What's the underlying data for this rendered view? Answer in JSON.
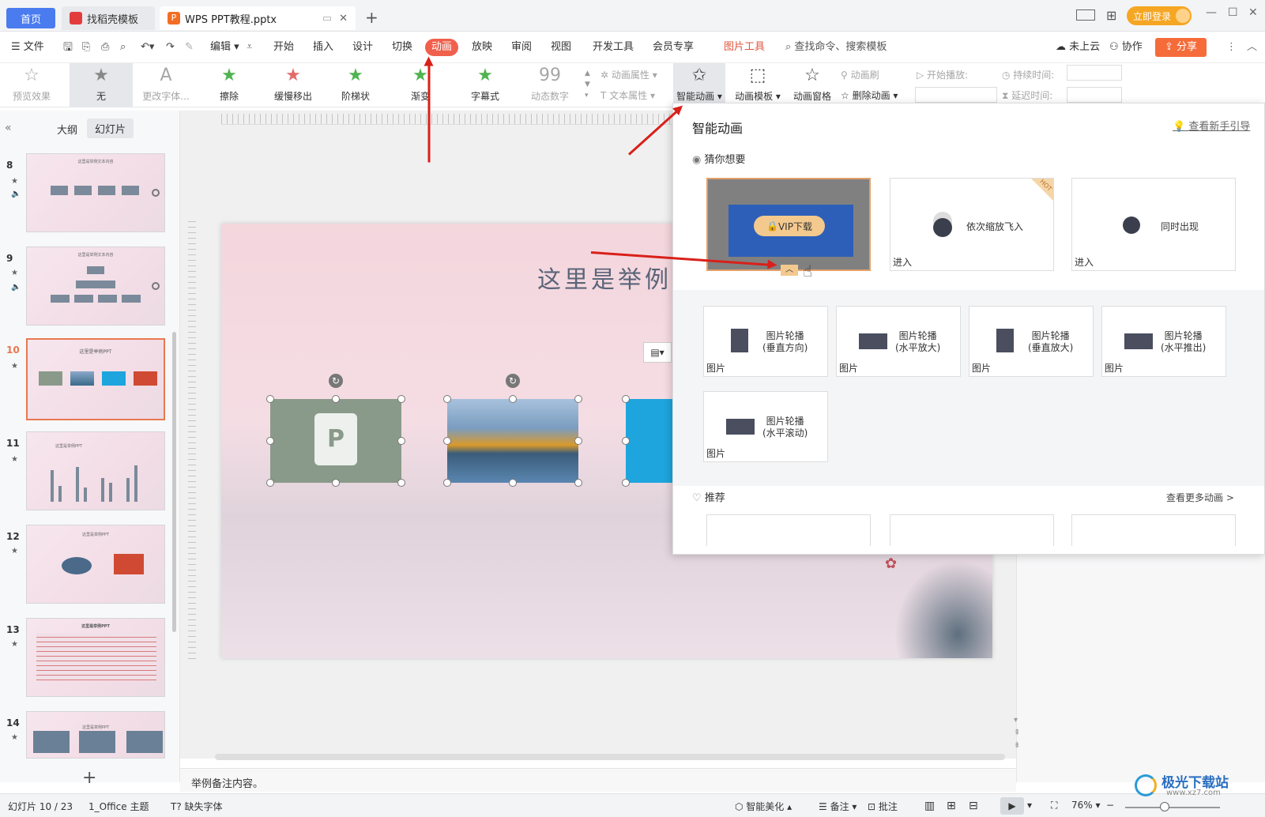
{
  "tabs": {
    "home": "首页",
    "daoke": "找稻壳模板",
    "doc": "WPS PPT教程.pptx",
    "add": "+"
  },
  "titlebar": {
    "login": "立即登录"
  },
  "menu": {
    "file": "文件",
    "edit": "编辑",
    "items": [
      "开始",
      "插入",
      "设计",
      "切换",
      "动画",
      "放映",
      "审阅",
      "视图",
      "开发工具",
      "会员专享"
    ],
    "active": "动画",
    "picture_tools": "图片工具",
    "search": "查找命令、搜索模板",
    "cloud": "未上云",
    "collab": "协作",
    "share": "分享"
  },
  "ribbon": {
    "preview": "预览效果",
    "effects": [
      {
        "label": "无",
        "icon": "★"
      },
      {
        "label": "更改字体...",
        "icon": "A"
      },
      {
        "label": "擦除",
        "icon": "★"
      },
      {
        "label": "缓慢移出",
        "icon": "★"
      },
      {
        "label": "阶梯状",
        "icon": "★"
      },
      {
        "label": "渐变",
        "icon": "★"
      },
      {
        "label": "字幕式",
        "icon": "★"
      },
      {
        "label": "动态数字",
        "icon": "99"
      }
    ],
    "anim_props": "动画属性",
    "text_props": "文本属性",
    "smart_anim": "智能动画",
    "anim_template": "动画模板",
    "anim_pane": "动画窗格",
    "anim_brush": "动画刷",
    "delete_anim": "删除动画",
    "start_play": "开始播放:",
    "duration": "持续时间:",
    "delay": "延迟时间:"
  },
  "leftpanel": {
    "outline": "大纲",
    "slides": "幻灯片",
    "numbers": [
      "8",
      "9",
      "10",
      "11",
      "12",
      "13",
      "14"
    ],
    "thumb_titles": [
      "这里是举例文本内容",
      "这里是举例文本内容",
      "这里是举例PPT",
      "这里是举例PPT",
      "这里是举例PPT",
      "这里是举例PPT",
      "这里是举例PPT"
    ],
    "add": "+"
  },
  "slide": {
    "title": "这里是举例PPT"
  },
  "notes": "举例备注内容。",
  "popup": {
    "title": "智能动画",
    "guide": "查看新手引导",
    "guess": "猜你想要",
    "vip": "VIP下载",
    "hot": "HOT",
    "cards_top": [
      {
        "label": "依次缩放飞入",
        "tag": "进入"
      },
      {
        "label": "同时出现",
        "tag": "进入"
      }
    ],
    "cards": [
      {
        "line1": "图片轮播",
        "line2": "(垂直方向)",
        "tag": "图片"
      },
      {
        "line1": "图片轮播",
        "line2": "(水平放大)",
        "tag": "图片"
      },
      {
        "line1": "图片轮播",
        "line2": "(垂直放大)",
        "tag": "图片"
      },
      {
        "line1": "图片轮播",
        "line2": "(水平推出)",
        "tag": "图片"
      },
      {
        "line1": "图片轮播",
        "line2": "(水平滚动)",
        "tag": "图片"
      }
    ],
    "recommend": "推荐",
    "more": "查看更多动画 >"
  },
  "status": {
    "slide_info": "幻灯片 10 / 23",
    "theme": "1_Office 主题",
    "missing_font": "缺失字体",
    "beautify": "智能美化",
    "notes": "备注",
    "comment": "批注",
    "zoom": "76%"
  },
  "watermark": {
    "site": "极光下载站",
    "url": "www.xz7.com"
  },
  "colors": {
    "accent": "#4a7cf0",
    "active_tab": "#f0604d",
    "arrow": "#d9201a",
    "share": "#f56c3a"
  }
}
